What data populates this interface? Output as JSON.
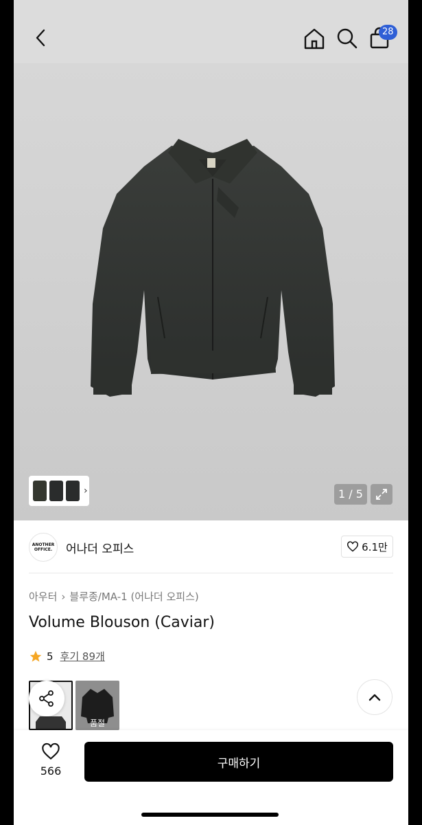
{
  "header": {
    "back_icon": "chevron-left-icon",
    "home_icon": "home-icon",
    "search_icon": "search-icon",
    "cart_icon": "shopping-bag-icon",
    "cart_count": "28",
    "badge_color": "#2f5fd6"
  },
  "gallery": {
    "counter": "1 / 5",
    "expand_icon": "expand-icon"
  },
  "brand": {
    "logo_text": "ANOTHER OFFICE.",
    "name": "어나더 오피스",
    "likes": "6.1만"
  },
  "product": {
    "breadcrumb": [
      "아우터",
      "블루종/MA-1 (어나더 오피스)"
    ],
    "title": "Volume Blouson (Caviar)",
    "rating": "5",
    "review_link": "후기 89개",
    "option_sold_label": "품절"
  },
  "bottom": {
    "wish_count": "566",
    "buy_label": "구매하기"
  }
}
